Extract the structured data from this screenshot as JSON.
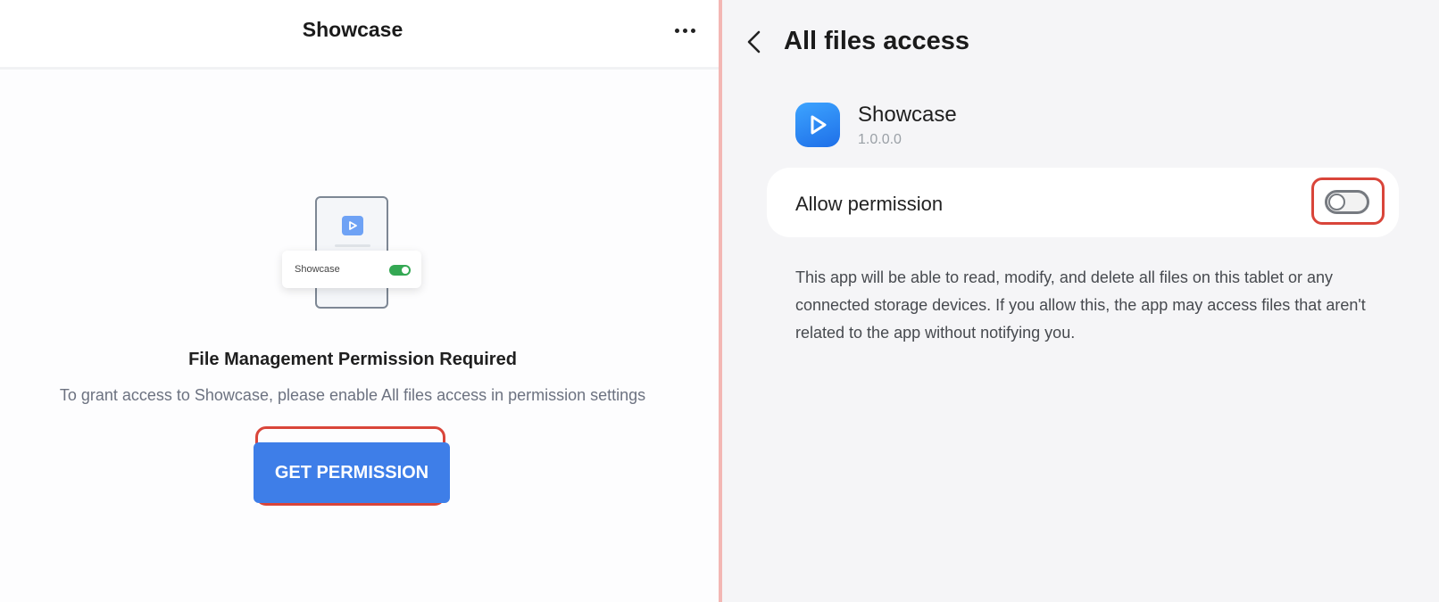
{
  "left": {
    "app_title": "Showcase",
    "more_icon": "more-horizontal-icon",
    "illustration": {
      "card_label": "Showcase",
      "toggle_state": "on"
    },
    "permission_title": "File Management Permission Required",
    "permission_desc": "To grant access to Showcase, please enable All files access in permission settings",
    "button_label": "GET PERMISSION"
  },
  "right": {
    "back_icon": "chevron-left-icon",
    "title": "All files access",
    "app": {
      "name": "Showcase",
      "version": "1.0.0.0",
      "icon": "play-icon"
    },
    "allow_label": "Allow permission",
    "allow_toggle_on": false,
    "description": "This app will be able to read, modify, and delete all files on this tablet or any connected storage devices. If you allow this, the app may access files that aren't related to the app without notifying you."
  },
  "colors": {
    "primary_button": "#3e7ee8",
    "highlight_outline": "#d9453a",
    "toggle_green": "#34a853",
    "settings_bg": "#f5f5f7"
  }
}
